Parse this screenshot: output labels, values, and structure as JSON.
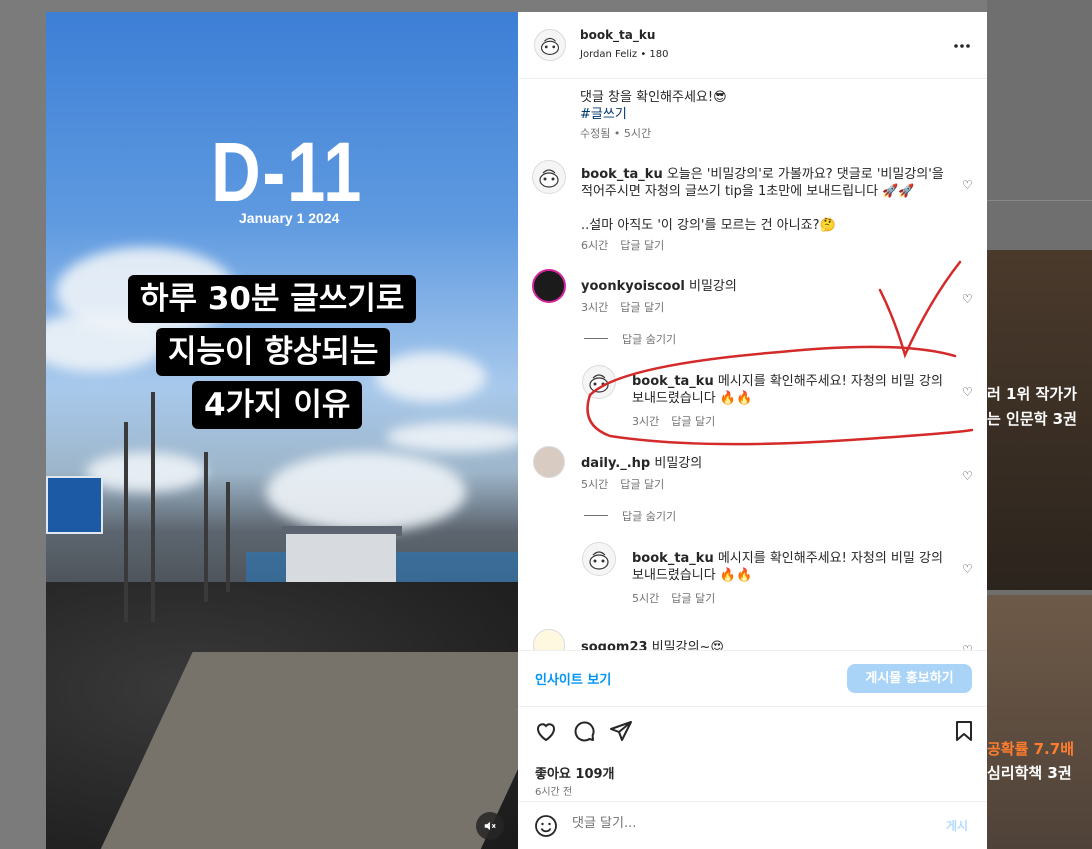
{
  "background": {
    "thumb1_lines": [
      "러 1위 작가가",
      "는 인문학 3권"
    ],
    "thumb2_lines": [
      "공확률 7.7배",
      "심리학책 3권"
    ]
  },
  "media": {
    "dday": "D-11",
    "date": "January 1 2024",
    "captions": [
      "하루 30분 글쓰기로",
      "지능이 향상되는",
      "4가지 이유"
    ],
    "mute_icon": "speaker-muted-icon"
  },
  "header": {
    "username": "book_ta_ku",
    "subtitle": "Jordan Feliz • 180",
    "more_icon": "more-horizontal-icon"
  },
  "caption": {
    "line1": "댓글 창을 확인해주세요!😎",
    "hashtag": "#글쓰기",
    "meta": "수정됨 • 5시간"
  },
  "comments": [
    {
      "username": "book_ta_ku",
      "lines": [
        "오늘은 '비밀강의'로 가볼까요? 댓글로 '비밀강의'을",
        "적어주시면 자청의 글쓰기 tip을 1초만에 보내드립니다 🚀🚀",
        "",
        "..설마 아직도 '이 강의'를 모르는 건 아니죠?🤔"
      ],
      "time": "6시간",
      "reply": "답글 달기"
    },
    {
      "username": "yoonkyoiscool",
      "text": "비밀강의",
      "time": "3시간",
      "reply": "답글 달기",
      "hide_replies": "답글 숨기기",
      "reply_item": {
        "username": "book_ta_ku",
        "lines": [
          "메시지를 확인해주세요! 자청의 비밀 강의",
          "보내드렸습니다 🔥🔥"
        ],
        "time": "3시간",
        "reply": "답글 달기"
      }
    },
    {
      "username": "daily._.hp",
      "text": "비밀강의",
      "time": "5시간",
      "reply": "답글 달기",
      "hide_replies": "답글 숨기기",
      "reply_item": {
        "username": "book_ta_ku",
        "lines": [
          "메시지를 확인해주세요! 자청의 비밀 강의",
          "보내드렸습니다 🔥🔥"
        ],
        "time": "5시간",
        "reply": "답글 달기"
      }
    },
    {
      "username": "sogom23",
      "text": "비밀강의~😍"
    }
  ],
  "insights": {
    "link": "인사이트 보기",
    "promote": "게시물 홍보하기"
  },
  "actions": {
    "likes": "좋아요 109개",
    "time": "6시간 전"
  },
  "comment_box": {
    "placeholder": "댓글 달기...",
    "post": "게시"
  },
  "colors": {
    "accent": "#0095f6",
    "annotation": "#d42a2a"
  }
}
